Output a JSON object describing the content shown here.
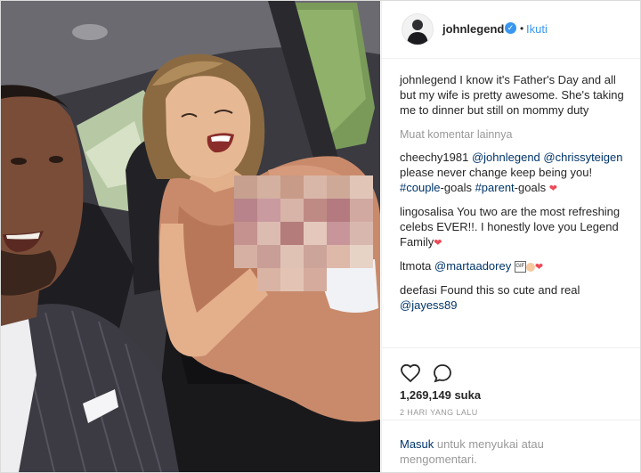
{
  "post": {
    "username": "johnlegend",
    "follow_label": "Ikuti",
    "separator": "•",
    "verified_badge": "verified-icon",
    "caption_user": "johnlegend",
    "caption_text": " I know it's Father's Day and all but my wife is pretty awesome. She's taking me to dinner but still on mommy duty",
    "load_more": "Muat komentar lainnya",
    "comments": [
      {
        "user": "cheechy1981",
        "parts": [
          " ",
          "@johnlegend",
          " ",
          "@chrissyteigen",
          " please never change keep being you! ",
          "#couple",
          "-goals ",
          "#parent",
          "-goals "
        ]
      },
      {
        "user": "lingosalisa",
        "text": " You two are the most refreshing celebs EVER!!. I honestly love you Legend Family"
      },
      {
        "user": "ltmota",
        "mention": "@martaadorey"
      },
      {
        "user": "deefasi",
        "text": " Found this so cute and real ",
        "mention": "@jayess89"
      }
    ],
    "likes": "1,269,149 suka",
    "date": "2 HARI YANG LALU",
    "login_link": "Masuk",
    "login_text": " untuk menyukai atau mengomentari."
  },
  "colors": {
    "link": "#003569",
    "follow": "#3897f0",
    "heart": "#ed4956",
    "muted": "#999999"
  }
}
